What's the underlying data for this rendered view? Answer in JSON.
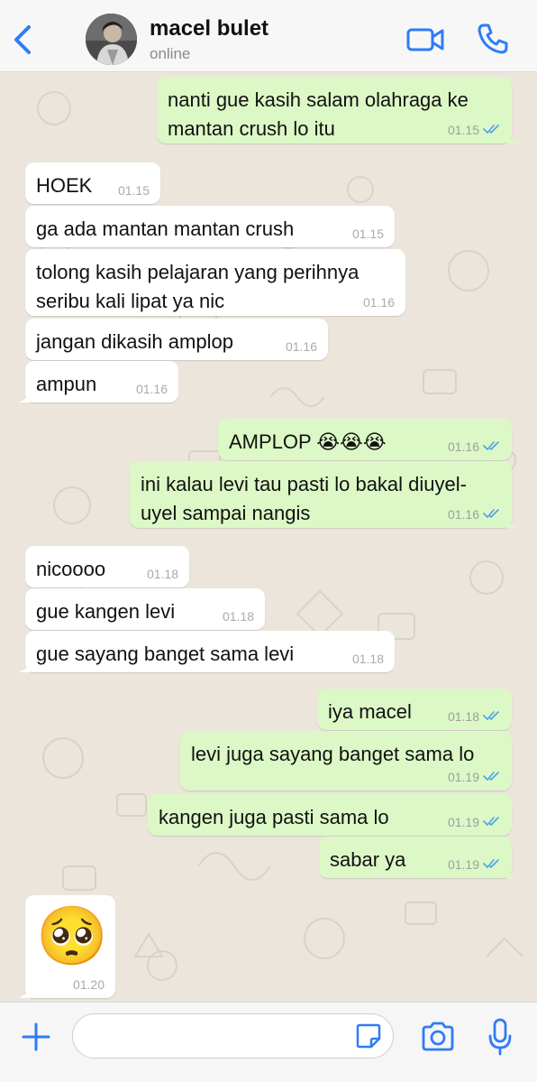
{
  "header": {
    "contact_name": "macel bulet",
    "status": "online"
  },
  "colors": {
    "accent": "#2f7cf6",
    "outgoing_bubble": "#dcf8c6",
    "incoming_bubble": "#ffffff",
    "read_ticks": "#4fa3e6",
    "chat_background": "#ebe5dc"
  },
  "icons": {
    "back": "chevron-left-icon",
    "video": "video-camera-icon",
    "call": "phone-icon",
    "attach": "plus-icon",
    "sticker": "sticker-icon",
    "camera": "camera-icon",
    "mic": "microphone-icon",
    "read_status": "double-check-icon"
  },
  "messages": [
    {
      "dir": "out",
      "text": "nanti gue kasih salam olahraga ke\nmantan crush lo itu",
      "time": "01.15",
      "read": true
    },
    {
      "dir": "in",
      "text": "HOEK",
      "time": "01.15"
    },
    {
      "dir": "in",
      "text": "ga ada mantan mantan crush",
      "time": "01.15"
    },
    {
      "dir": "in",
      "text": "tolong kasih pelajaran yang perihnya\nseribu kali lipat ya nic",
      "time": "01.16"
    },
    {
      "dir": "in",
      "text": "jangan dikasih amplop",
      "time": "01.16"
    },
    {
      "dir": "in",
      "text": "ampun",
      "time": "01.16"
    },
    {
      "dir": "out",
      "text": "AMPLOP 😭😭😭",
      "time": "01.16",
      "read": true
    },
    {
      "dir": "out",
      "text": "ini kalau levi tau pasti lo bakal diuyel-\nuyel sampai nangis",
      "time": "01.16",
      "read": true
    },
    {
      "dir": "in",
      "text": "nicoooo",
      "time": "01.18"
    },
    {
      "dir": "in",
      "text": "gue kangen levi",
      "time": "01.18"
    },
    {
      "dir": "in",
      "text": "gue sayang banget sama levi",
      "time": "01.18"
    },
    {
      "dir": "out",
      "text": "iya macel",
      "time": "01.18",
      "read": true
    },
    {
      "dir": "out",
      "text": "levi juga sayang banget sama lo",
      "time": "01.19",
      "read": true
    },
    {
      "dir": "out",
      "text": "kangen juga pasti sama lo",
      "time": "01.19",
      "read": true
    },
    {
      "dir": "out",
      "text": "sabar ya",
      "time": "01.19",
      "read": true
    },
    {
      "dir": "in",
      "text": "🥺",
      "time": "01.20",
      "emoji_only": true
    }
  ],
  "composer": {
    "value": "",
    "placeholder": ""
  }
}
